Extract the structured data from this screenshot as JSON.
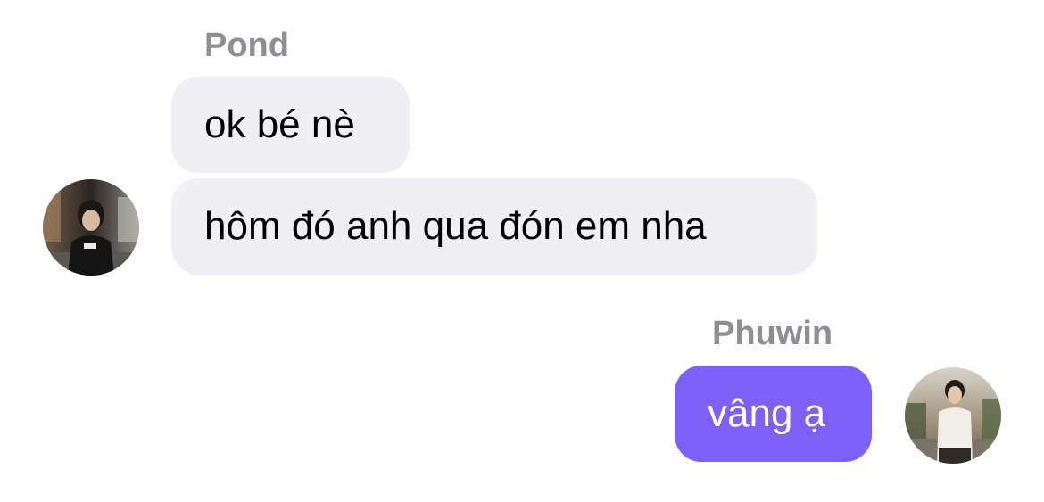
{
  "conversation": {
    "messages": [
      {
        "sender": "Pond",
        "text": "ok bé nè"
      },
      {
        "sender": "Pond",
        "text": "hôm đó anh qua đón em nha"
      },
      {
        "sender": "Phuwin",
        "text": "vâng ạ"
      }
    ],
    "senders": {
      "pond": {
        "name": "Pond"
      },
      "phuwin": {
        "name": "Phuwin"
      }
    }
  },
  "colors": {
    "incoming_bubble": "#efeff4",
    "outgoing_bubble": "#7b61f8",
    "sender_name": "#8e8e93"
  },
  "icons": {
    "pond_avatar": "avatar-photo",
    "phuwin_avatar": "avatar-photo"
  }
}
